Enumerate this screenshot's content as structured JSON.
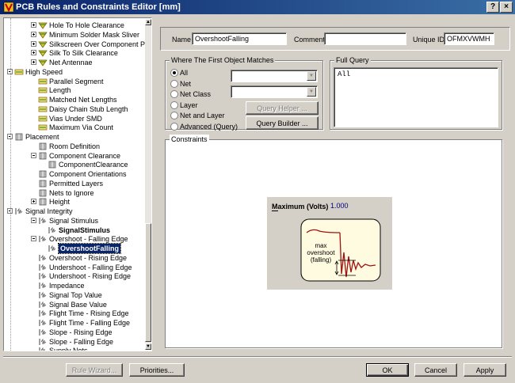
{
  "window": {
    "title": "PCB Rules and Constraints Editor [mm]",
    "help_label": "?",
    "close_label": "×"
  },
  "tree": {
    "items": [
      {
        "label": "Hole To Hole Clearance",
        "bold": false,
        "selected": false
      },
      {
        "label": "Minimum Solder Mask Sliver",
        "bold": false,
        "selected": false
      },
      {
        "label": "Silkscreen Over Component Pads",
        "bold": false,
        "selected": false
      },
      {
        "label": "Silk To Silk Clearance",
        "bold": false,
        "selected": false
      },
      {
        "label": "Net Antennae",
        "bold": false,
        "selected": false
      },
      {
        "label": "High Speed",
        "bold": false,
        "selected": false
      },
      {
        "label": "Parallel Segment",
        "bold": false,
        "selected": false
      },
      {
        "label": "Length",
        "bold": false,
        "selected": false
      },
      {
        "label": "Matched Net Lengths",
        "bold": false,
        "selected": false
      },
      {
        "label": "Daisy Chain Stub Length",
        "bold": false,
        "selected": false
      },
      {
        "label": "Vias Under SMD",
        "bold": false,
        "selected": false
      },
      {
        "label": "Maximum Via Count",
        "bold": false,
        "selected": false
      },
      {
        "label": "Placement",
        "bold": false,
        "selected": false
      },
      {
        "label": "Room Definition",
        "bold": false,
        "selected": false
      },
      {
        "label": "Component Clearance",
        "bold": false,
        "selected": false
      },
      {
        "label": "ComponentClearance",
        "bold": false,
        "selected": false
      },
      {
        "label": "Component Orientations",
        "bold": false,
        "selected": false
      },
      {
        "label": "Permitted Layers",
        "bold": false,
        "selected": false
      },
      {
        "label": "Nets to Ignore",
        "bold": false,
        "selected": false
      },
      {
        "label": "Height",
        "bold": false,
        "selected": false
      },
      {
        "label": "Signal Integrity",
        "bold": false,
        "selected": false
      },
      {
        "label": "Signal Stimulus",
        "bold": false,
        "selected": false
      },
      {
        "label": "SignalStimulus",
        "bold": true,
        "selected": false
      },
      {
        "label": "Overshoot - Falling Edge",
        "bold": false,
        "selected": false
      },
      {
        "label": "OvershootFalling",
        "bold": true,
        "selected": true
      },
      {
        "label": "Overshoot - Rising Edge",
        "bold": false,
        "selected": false
      },
      {
        "label": "Undershoot - Falling Edge",
        "bold": false,
        "selected": false
      },
      {
        "label": "Undershoot - Rising Edge",
        "bold": false,
        "selected": false
      },
      {
        "label": "Impedance",
        "bold": false,
        "selected": false
      },
      {
        "label": "Signal Top Value",
        "bold": false,
        "selected": false
      },
      {
        "label": "Signal Base Value",
        "bold": false,
        "selected": false
      },
      {
        "label": "Flight Time - Rising Edge",
        "bold": false,
        "selected": false
      },
      {
        "label": "Flight Time - Falling Edge",
        "bold": false,
        "selected": false
      },
      {
        "label": "Slope - Rising Edge",
        "bold": false,
        "selected": false
      },
      {
        "label": "Slope - Falling Edge",
        "bold": false,
        "selected": false
      },
      {
        "label": "Supply Nets",
        "bold": false,
        "selected": false
      }
    ]
  },
  "rule": {
    "name_label": "Name",
    "name_value": "OvershootFalling",
    "comment_label": "Comment",
    "comment_value": "",
    "uid_label": "Unique ID",
    "uid_value": "OFMXVWMH"
  },
  "first_object": {
    "title": "Where The First Object Matches",
    "options": [
      "All",
      "Net",
      "Net Class",
      "Layer",
      "Net and Layer",
      "Advanced (Query)"
    ],
    "selected": "All",
    "query_helper_label": "Query Helper ...",
    "query_builder_label": "Query Builder ..."
  },
  "full_query": {
    "title": "Full Query",
    "text": "All"
  },
  "constraints": {
    "title": "Constraints",
    "max_label": "Maximum (Volts)",
    "max_value": "1.000",
    "diagram_text": [
      "max",
      "overshoot",
      "(falling)"
    ]
  },
  "footer": {
    "rule_wizard_label": "Rule Wizard...",
    "priorities_label": "Priorities...",
    "ok_label": "OK",
    "cancel_label": "Cancel",
    "apply_label": "Apply"
  },
  "colors": {
    "title_start": "#0a246a",
    "title_end": "#3a6ea5",
    "selection": "#0a246a",
    "value_blue": "#000080",
    "waveform": "#a01010"
  }
}
